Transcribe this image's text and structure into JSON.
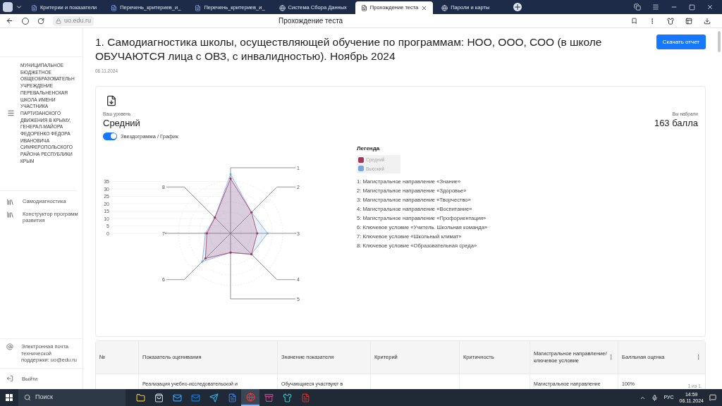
{
  "browser": {
    "tabs": [
      {
        "title": "Критерии и показатели",
        "selected": false
      },
      {
        "title": "Перечень_критериев_и_",
        "selected": false
      },
      {
        "title": "Перечень_критериев_и_",
        "selected": false
      },
      {
        "title": "Система Сбора Данных",
        "selected": false
      },
      {
        "title": "Прохождение теста",
        "selected": true
      },
      {
        "title": "Пароли и карты",
        "selected": false
      }
    ],
    "address": "uo.edu.ru",
    "page_title": "Прохождение теста"
  },
  "sidebar": {
    "organization": "МУНИЦИПАЛЬНОЕ БЮДЖЕТНОЕ ОБЩЕОБРАЗОВАТЕЛЬН УЧРЕЖДЕНИЕ ПЕРЕВАЛЬНЕНСКАЯ ШКОЛА ИМЕНИ УЧАСТНИКА ПАРТИЗАНСКОГО ДВИЖЕНИЯ В КРЫМУ, ГЕНЕРАЛ-МАЙОРА ФЕДОРЕНКО ФЁДОРА ИВАНОВИЧА СИМФЕРОПОЛЬСКОГО РАЙОНА РЕСПУБЛИКИ КРЫМ",
    "items": [
      {
        "label": "Самодиагностика"
      },
      {
        "label": "Конструктор программ развития"
      }
    ],
    "support": "Электронная почта технической поддержки: uo@edu.ru",
    "logout": "Выйти"
  },
  "header": {
    "title": "1. Самодиагностика школы, осуществляющей обучение по программам: НОО, ООО, СОО (в школе ОБУЧАЮТСЯ лица с ОВЗ, с инвалидностью). Ноябрь 2024",
    "date": "06.11.2024",
    "download_button": "Скачать отчет"
  },
  "result": {
    "level_label": "Ваш уровень",
    "level": "Средний",
    "score_label": "Вы набрали",
    "score": "163 балла",
    "toggle": {
      "label": "Звездограмма / График",
      "on": true
    },
    "radar": {
      "scale_labels": [
        "35",
        "30",
        "25",
        "20",
        "15",
        "10",
        "5",
        "0"
      ],
      "axis_labels": [
        "1",
        "8",
        "2",
        "7",
        "3",
        "6",
        "4",
        "5"
      ],
      "series": [
        {
          "name": "Средний",
          "color": "#a3365c"
        },
        {
          "name": "Высокий",
          "color": "#7ba4e6"
        }
      ]
    },
    "legend_title": "Легенда",
    "axis_descriptions": [
      "1: Магистральное направление «Знание»",
      "2: Магистральное направление «Здоровье»",
      "3: Магистральное направление «Творчество»",
      "4: Магистральное направление «Воспитание»",
      "5: Магистральное направление «Профориентация»",
      "6: Ключевое условие «Учитель. Школьная команда»",
      "7: Ключевое условие «Школьный климат»",
      "8: Ключевое условие «Образовательная среда»"
    ]
  },
  "table": {
    "columns": [
      {
        "label": "№",
        "menu": false
      },
      {
        "label": "Показатель оценивания",
        "menu": false
      },
      {
        "label": "Значение показателя",
        "menu": false
      },
      {
        "label": "Критерий",
        "menu": false
      },
      {
        "label": "Критичность",
        "menu": false
      },
      {
        "label": "Магистральное направление/ключевое условие",
        "menu": true
      },
      {
        "label": "Балльная оценка",
        "menu": true
      }
    ],
    "rows": [
      {
        "cells": [
          null,
          "Реализация учебно-исследовательской и",
          "Обучающиеся участвуют в",
          null,
          null,
          "Магистральное направление",
          "100%"
        ]
      }
    ],
    "pager": "1 из 1"
  },
  "taskbar": {
    "search_placeholder": "Поиск",
    "apps": [
      {
        "kind": "folder",
        "selected": false
      },
      {
        "kind": "store",
        "selected": false
      },
      {
        "kind": "mail",
        "selected": false
      },
      {
        "kind": "outlook",
        "selected": false
      },
      {
        "kind": "telegram",
        "selected": false
      },
      {
        "kind": "word",
        "selected": false
      },
      {
        "kind": "browser",
        "selected": true
      },
      {
        "kind": "archive",
        "selected": false
      },
      {
        "kind": "teal",
        "selected": false
      },
      {
        "kind": "pdf",
        "selected": false
      }
    ],
    "language": "РУС",
    "time": "14:59",
    "date": "06.11.2024"
  }
}
